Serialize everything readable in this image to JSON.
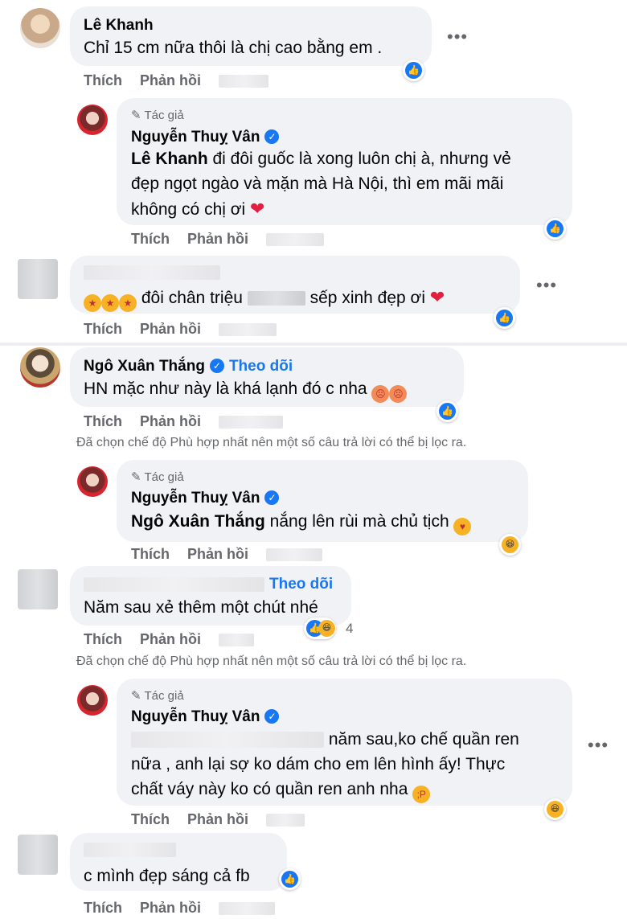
{
  "ui": {
    "like_label": "Thích",
    "reply_label": "Phản hồi",
    "author_badge": "Tác giả",
    "follow_label": "Theo dõi",
    "filter_notice": "Đã chọn chế độ Phù hợp nhất nên một số câu trả lời có thể bị lọc ra.",
    "more_icon": "•••"
  },
  "comments": [
    {
      "name": "Lê Khanh",
      "text": "Chỉ 15 cm nữa thôi là chị cao bằng em ."
    },
    {
      "name": "Nguyễn Thuỵ Vân",
      "mention": "Lê Khanh",
      "text_line1": " đi đôi guốc là xong luôn chị à, nhưng vẻ",
      "text_line2": "đẹp ngọt ngào và mặn mà Hà Nội, thì em mãi mãi",
      "text_line3": "không có chị ơi"
    },
    {
      "name": "",
      "text_a": "đôi chân triệu",
      "text_b": "sếp xinh đẹp ơi"
    },
    {
      "name": "Ngô Xuân Thắng",
      "text": "HN mặc như này là khá lạnh đó c nha"
    },
    {
      "name": "Nguyễn Thuỵ Vân",
      "mention": "Ngô Xuân Thắng",
      "text": " nắng lên rùi mà chủ tịch"
    },
    {
      "name": "",
      "text": "Năm sau xẻ thêm một chút nhé",
      "reaction_count": "4"
    },
    {
      "name": "Nguyễn Thuỵ Vân",
      "text_line1": "năm sau,ko chế quần ren",
      "text_line2": "nữa , anh lại sợ ko dám cho em lên hình ấy! Thực",
      "text_line3": "chất váy này ko có quần ren anh nha"
    },
    {
      "name": "",
      "text": "c mình đẹp sáng cả fb"
    }
  ],
  "colors": {
    "accent": "#1877f2",
    "bubble": "#f0f2f5",
    "muted": "#65676b"
  }
}
